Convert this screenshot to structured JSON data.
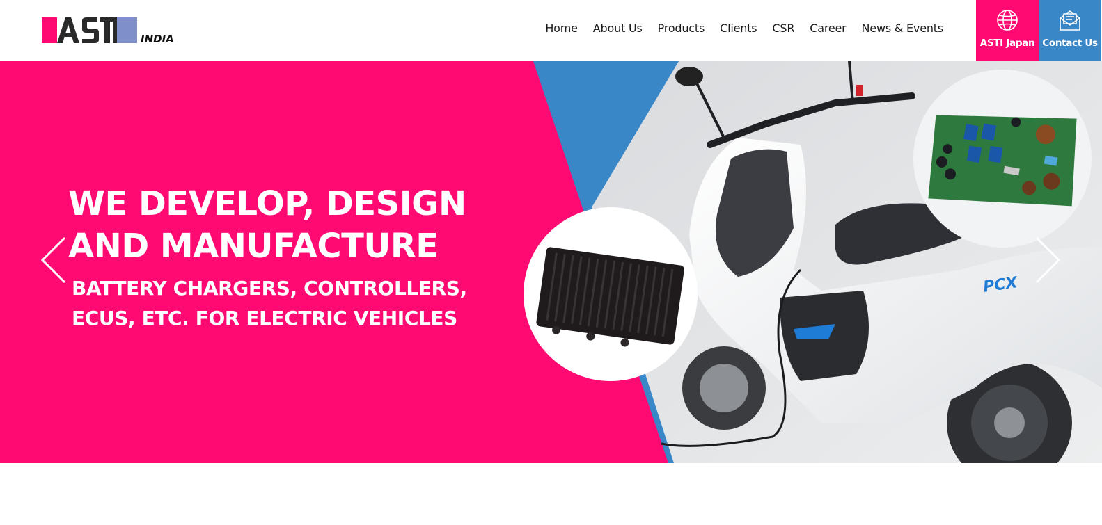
{
  "brand": {
    "logo_text": "ASTI",
    "logo_sub": "INDIA",
    "pink": "#ff0a72",
    "blue": "#3a87c8",
    "logo_blue": "#7f8fc9"
  },
  "nav": {
    "items": [
      "Home",
      "About Us",
      "Products",
      "Clients",
      "CSR",
      "Career",
      "News & Events"
    ]
  },
  "cta": {
    "japan": {
      "label": "ASTI Japan",
      "icon": "globe-icon"
    },
    "contact": {
      "label": "Contact Us",
      "icon": "envelope-icon"
    }
  },
  "hero": {
    "headline_1": "WE DEVELOP, DESIGN",
    "headline_2": "AND MANUFACTURE",
    "sub_1": "BATTERY CHARGERS, CONTROLLERS,",
    "sub_2": "ECUS, ETC. FOR ELECTRIC VEHICLES",
    "prev_icon": "chevron-left-icon",
    "next_icon": "chevron-right-icon"
  }
}
